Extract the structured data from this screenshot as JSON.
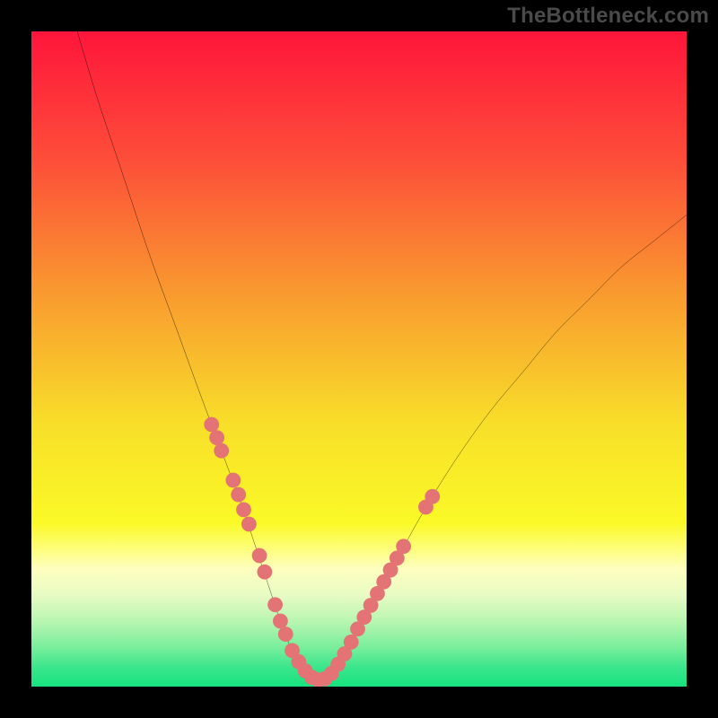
{
  "watermark": "TheBottleneck.com",
  "chart_data": {
    "type": "line",
    "title": "",
    "xlabel": "",
    "ylabel": "",
    "xlim": [
      0,
      100
    ],
    "ylim": [
      0,
      100
    ],
    "grid": false,
    "legend": false,
    "series": [
      {
        "name": "bottleneck-curve",
        "color": "#000000",
        "x": [
          7,
          10,
          14,
          18,
          22,
          26,
          29,
          32,
          34,
          36,
          38,
          40,
          42,
          44,
          46,
          48,
          50,
          55,
          60,
          65,
          70,
          75,
          80,
          85,
          90,
          95,
          100
        ],
        "y": [
          100,
          90,
          78,
          66,
          55,
          44,
          36,
          28,
          22,
          16,
          10,
          5,
          2,
          1,
          2,
          5,
          9,
          18,
          27,
          35,
          42,
          48,
          54,
          59,
          64,
          68,
          72
        ]
      }
    ],
    "highlight_points": {
      "name": "curve-highlight-dots",
      "color": "#e37374",
      "points": [
        {
          "x": 27.5,
          "y": 40
        },
        {
          "x": 28.3,
          "y": 38
        },
        {
          "x": 29.0,
          "y": 36
        },
        {
          "x": 30.8,
          "y": 31.5
        },
        {
          "x": 31.6,
          "y": 29.3
        },
        {
          "x": 32.4,
          "y": 27
        },
        {
          "x": 33.2,
          "y": 24.8
        },
        {
          "x": 34.8,
          "y": 20
        },
        {
          "x": 35.6,
          "y": 17.5
        },
        {
          "x": 37.2,
          "y": 12.5
        },
        {
          "x": 38.0,
          "y": 10
        },
        {
          "x": 38.8,
          "y": 8
        },
        {
          "x": 39.8,
          "y": 5.5
        },
        {
          "x": 40.8,
          "y": 3.8
        },
        {
          "x": 41.8,
          "y": 2.4
        },
        {
          "x": 42.8,
          "y": 1.4
        },
        {
          "x": 43.8,
          "y": 1.0
        },
        {
          "x": 44.8,
          "y": 1.2
        },
        {
          "x": 45.8,
          "y": 2.0
        },
        {
          "x": 46.8,
          "y": 3.4
        },
        {
          "x": 47.8,
          "y": 5.0
        },
        {
          "x": 48.8,
          "y": 6.8
        },
        {
          "x": 49.8,
          "y": 8.8
        },
        {
          "x": 50.8,
          "y": 10.6
        },
        {
          "x": 51.8,
          "y": 12.4
        },
        {
          "x": 52.8,
          "y": 14.2
        },
        {
          "x": 53.8,
          "y": 16.0
        },
        {
          "x": 54.8,
          "y": 17.8
        },
        {
          "x": 55.8,
          "y": 19.6
        },
        {
          "x": 56.8,
          "y": 21.4
        },
        {
          "x": 60.2,
          "y": 27.4
        },
        {
          "x": 61.2,
          "y": 29.0
        }
      ]
    },
    "background_gradient": {
      "stops": [
        {
          "offset": 0.0,
          "color": "#ff153b"
        },
        {
          "offset": 0.2,
          "color": "#fd4f39"
        },
        {
          "offset": 0.4,
          "color": "#f99a2f"
        },
        {
          "offset": 0.6,
          "color": "#f8df29"
        },
        {
          "offset": 0.75,
          "color": "#faf927"
        },
        {
          "offset": 0.79,
          "color": "#fefe7c"
        },
        {
          "offset": 0.82,
          "color": "#fefebf"
        },
        {
          "offset": 0.86,
          "color": "#e8fbc4"
        },
        {
          "offset": 0.9,
          "color": "#b9f6b2"
        },
        {
          "offset": 0.94,
          "color": "#79ee9c"
        },
        {
          "offset": 0.97,
          "color": "#3ce68c"
        },
        {
          "offset": 1.0,
          "color": "#16e27e"
        }
      ]
    }
  }
}
